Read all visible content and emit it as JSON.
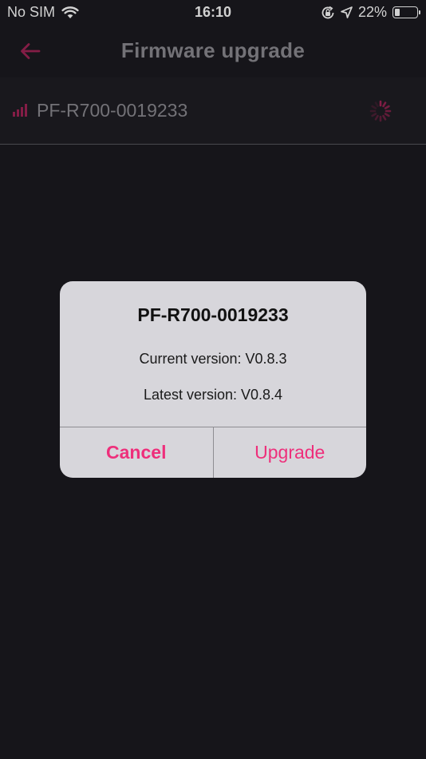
{
  "status_bar": {
    "carrier": "No SIM",
    "time": "16:10",
    "battery_percent_text": "22%",
    "battery_level": 0.22,
    "icons": [
      "wifi-icon",
      "orientation-lock-icon",
      "location-arrow-icon",
      "battery-icon"
    ]
  },
  "nav": {
    "title": "Firmware upgrade",
    "back_icon": "back-arrow-icon"
  },
  "device_row": {
    "name": "PF-R700-0019233",
    "signal_icon": "signal-strength-icon",
    "loading_icon": "spinner-icon"
  },
  "dialog": {
    "title": "PF-R700-0019233",
    "current_version": "Current version: V0.8.3",
    "latest_version": "Latest version: V0.8.4",
    "cancel_label": "Cancel",
    "upgrade_label": "Upgrade"
  },
  "colors": {
    "accent": "#ee2f7b",
    "accent_dim": "#a12456",
    "background": "#1b1a20",
    "dialog_bg": "#d7d6db",
    "muted_text": "#8d8b92"
  }
}
